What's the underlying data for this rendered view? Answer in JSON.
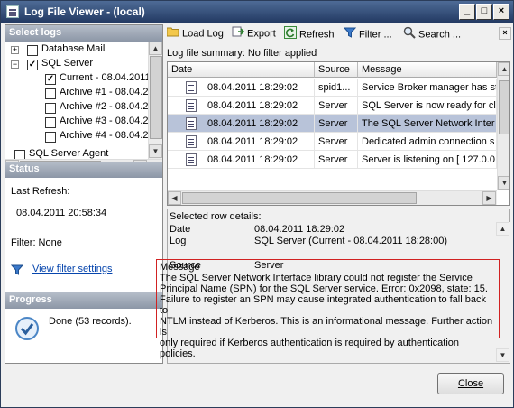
{
  "window": {
    "title": "Log File Viewer - (local)"
  },
  "select_logs": {
    "heading": "Select logs",
    "items": [
      {
        "label": "Database Mail",
        "checked": false,
        "expander": "+"
      },
      {
        "label": "SQL Server",
        "checked": true,
        "expander": "−"
      },
      {
        "label": "Current - 08.04.2011 1",
        "checked": true
      },
      {
        "label": "Archive #1 - 08.04.20",
        "checked": false
      },
      {
        "label": "Archive #2 - 08.04.20",
        "checked": false
      },
      {
        "label": "Archive #3 - 08.04.20",
        "checked": false
      },
      {
        "label": "Archive #4 - 08.04.20",
        "checked": false
      },
      {
        "label": "SQL Server Agent",
        "checked": false
      }
    ]
  },
  "status": {
    "heading": "Status",
    "last_refresh_label": "Last Refresh:",
    "last_refresh_value": "08.04.2011 20:58:34",
    "filter": "Filter: None",
    "view_filter_link": "View filter settings"
  },
  "progress": {
    "heading": "Progress",
    "done": "Done (53 records)."
  },
  "toolbar": {
    "load_log": "Load Log",
    "export": "Export",
    "refresh": "Refresh",
    "filter": "Filter ...",
    "search": "Search ..."
  },
  "summary": "Log file summary: No filter applied",
  "grid": {
    "columns": [
      "Date",
      "Source",
      "Message"
    ],
    "rows": [
      {
        "date": "08.04.2011 18:29:02",
        "source": "spid1...",
        "message": "Service Broker manager has st"
      },
      {
        "date": "08.04.2011 18:29:02",
        "source": "Server",
        "message": "SQL Server is now ready for cli"
      },
      {
        "date": "08.04.2011 18:29:02",
        "source": "Server",
        "message": "The SQL Server Network Inter"
      },
      {
        "date": "08.04.2011 18:29:02",
        "source": "Server",
        "message": "Dedicated admin connection s"
      },
      {
        "date": "08.04.2011 18:29:02",
        "source": "Server",
        "message": "Server is listening on [ 127.0.0."
      }
    ],
    "selected_index": 2
  },
  "details": {
    "heading": "Selected row details:",
    "date_label": "Date",
    "date_value": "08.04.2011 18:29:02",
    "log_label": "Log",
    "log_value": "SQL Server (Current - 08.04.2011 18:28:00)",
    "source_label": "Source",
    "source_value": "Server",
    "message_label": "Message",
    "message_lines": [
      "The SQL Server Network Interface library could not register the Service",
      "Principal Name (SPN) for the SQL Server service. Error: 0x2098, state: 15.",
      "Failure to register an SPN may cause integrated authentication to fall back to",
      "NTLM instead of Kerberos. This is an informational message. Further action is",
      "only required if Kerberos authentication is required by authentication policies."
    ]
  },
  "close_button": "Close",
  "colors": {
    "selected_row": "#b8c3d9",
    "highlight_border": "#d12222",
    "link": "#0645ad"
  }
}
